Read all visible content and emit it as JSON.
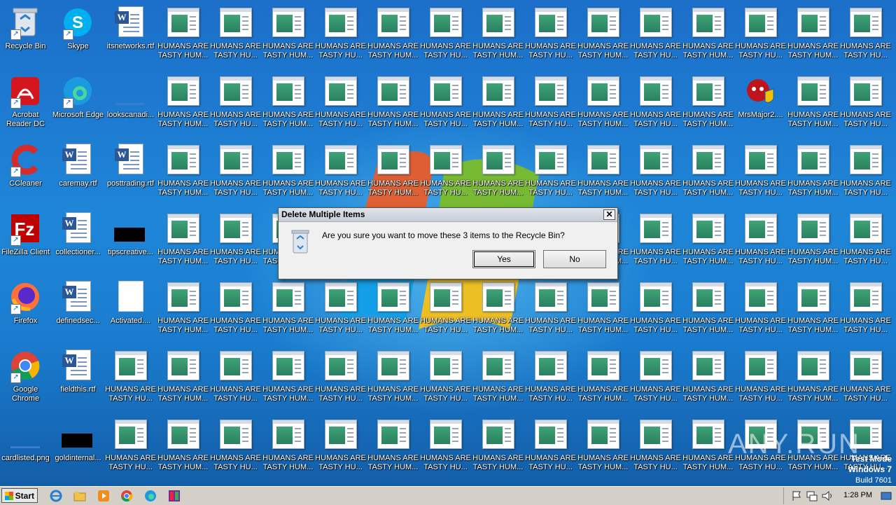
{
  "desktop": {
    "system_icons": [
      {
        "name": "recycle-bin",
        "label": "Recycle Bin"
      },
      {
        "name": "skype",
        "label": "Skype"
      },
      {
        "name": "itsnetworks",
        "label": "itsnetworks.rtf"
      },
      {
        "name": "acrobat",
        "label": "Acrobat Reader DC"
      },
      {
        "name": "edge",
        "label": "Microsoft Edge"
      },
      {
        "name": "lookscanadi",
        "label": "lookscanadi..."
      },
      {
        "name": "ccleaner",
        "label": "CCleaner"
      },
      {
        "name": "caremay",
        "label": "caremay.rtf"
      },
      {
        "name": "posttrading",
        "label": "posttrading.rtf"
      },
      {
        "name": "filezilla",
        "label": "FileZilla Client"
      },
      {
        "name": "collectioner",
        "label": "collectioner..."
      },
      {
        "name": "tipscreative",
        "label": "tipscreative..."
      },
      {
        "name": "firefox",
        "label": "Firefox"
      },
      {
        "name": "definedsec",
        "label": "definedsec..."
      },
      {
        "name": "activated",
        "label": "Activated...."
      },
      {
        "name": "chrome",
        "label": "Google Chrome"
      },
      {
        "name": "fieldthis",
        "label": "fieldthis.rtf"
      },
      {
        "name": "cardlisted",
        "label": "cardlisted.png"
      },
      {
        "name": "goldinternal",
        "label": "goldinternal..."
      }
    ],
    "app_icon_label": "HUMANS ARE TASTY HU...",
    "app_icon_label_alt": "HUMANS ARE TASTY HUM...",
    "mrsmajor_label": "MrsMajor2....",
    "watermark": "ANY.RUN",
    "os_line1": "Test Mode",
    "os_line2": "Windows 7",
    "os_line3": "Build 7601"
  },
  "dialog": {
    "title": "Delete Multiple Items",
    "close": "✕",
    "message": "Are you sure you want to move these 3 items to the Recycle Bin?",
    "yes": "Yes",
    "no": "No"
  },
  "taskbar": {
    "start": "Start",
    "clock": "1:28 PM"
  },
  "colors": {
    "desktop": "#1e86d8",
    "taskbar": "#d4d0c8",
    "dialog": "#f0f0f0"
  }
}
